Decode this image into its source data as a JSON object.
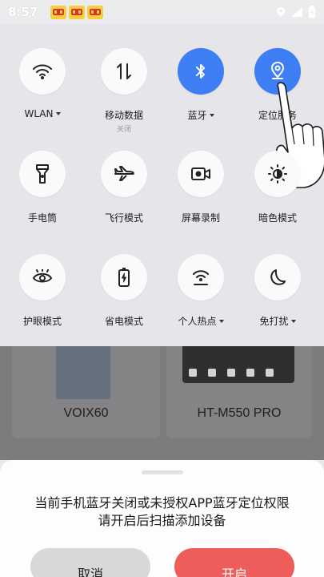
{
  "status_bar": {
    "time": "8:57"
  },
  "quick_settings": {
    "row1": [
      {
        "label": "WLAN",
        "sub": "",
        "dropdown": true,
        "on": false
      },
      {
        "label": "移动数据",
        "sub": "关闭",
        "dropdown": false,
        "on": false
      },
      {
        "label": "蓝牙",
        "sub": "",
        "dropdown": true,
        "on": true
      },
      {
        "label": "定位服务",
        "sub": "",
        "dropdown": false,
        "on": true
      }
    ],
    "row2": [
      {
        "label": "手电筒"
      },
      {
        "label": "飞行模式"
      },
      {
        "label": "屏幕录制"
      },
      {
        "label": "暗色模式"
      }
    ],
    "row3": [
      {
        "label": "护眼模式",
        "dropdown": false
      },
      {
        "label": "省电模式",
        "dropdown": false
      },
      {
        "label": "个人热点",
        "dropdown": true
      },
      {
        "label": "免打扰",
        "dropdown": true
      }
    ]
  },
  "devices": [
    {
      "name": "VOIX60"
    },
    {
      "name": "HT-M550 PRO"
    }
  ],
  "sheet": {
    "message_line1": "当前手机蓝牙关闭或未授权APP蓝牙定位权限",
    "message_line2": "请开启后扫描添加设备",
    "cancel_label": "取消",
    "open_label": "开启"
  },
  "colors": {
    "accent_blue": "#3d7ef5",
    "open_button": "#ee5d5a"
  }
}
